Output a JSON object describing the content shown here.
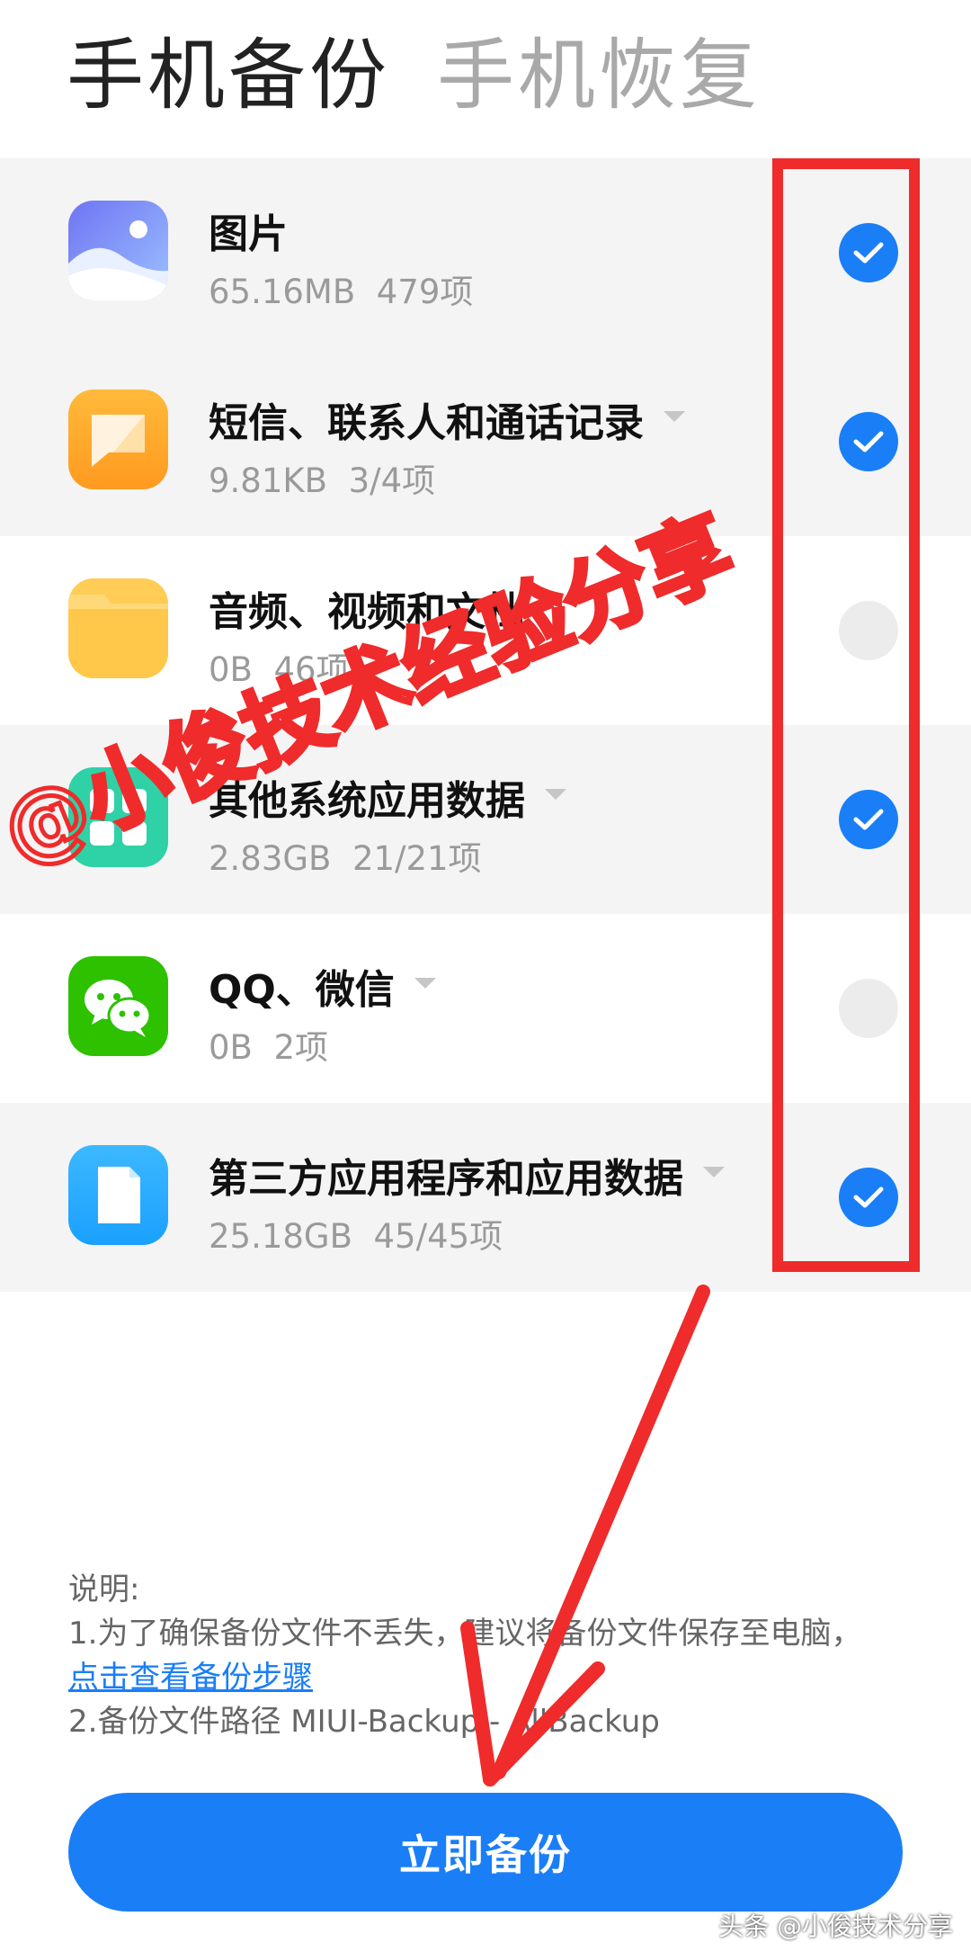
{
  "tabs": [
    {
      "label": "手机备份",
      "active": true
    },
    {
      "label": "手机恢复",
      "active": false
    }
  ],
  "items": [
    {
      "title": "图片",
      "size": "65.16MB",
      "count": "479项",
      "checked": true,
      "icon": "gallery-icon",
      "dropdown": false
    },
    {
      "title": "短信、联系人和通话记录",
      "size": "9.81KB",
      "count": "3/4项",
      "checked": true,
      "icon": "messages-icon",
      "dropdown": true
    },
    {
      "title": "音频、视频和文档",
      "size": "0B",
      "count": "46项",
      "checked": false,
      "icon": "folder-icon",
      "dropdown": false
    },
    {
      "title": "其他系统应用数据",
      "size": "2.83GB",
      "count": "21/21项",
      "checked": true,
      "icon": "apps-icon",
      "dropdown": true
    },
    {
      "title": "QQ、微信",
      "size": "0B",
      "count": "2项",
      "checked": false,
      "icon": "wechat-icon",
      "dropdown": true
    },
    {
      "title": "第三方应用程序和应用数据",
      "size": "25.18GB",
      "count": "45/45项",
      "checked": true,
      "icon": "file-icon",
      "dropdown": true
    }
  ],
  "notes": {
    "heading": "说明:",
    "line1": "1.为了确保备份文件不丢失，建议将备份文件保存至电脑，",
    "link": "点击查看备份步骤",
    "line2": "2.备份文件路径 MIUI-Backup - AllBackup"
  },
  "backup_button": "立即备份",
  "watermark": "@小俊技术经验分享",
  "corner_credit": "头条 @小俊技术分享",
  "colors": {
    "accent": "#1a7ef7",
    "annotation": "#ef2b2b"
  }
}
